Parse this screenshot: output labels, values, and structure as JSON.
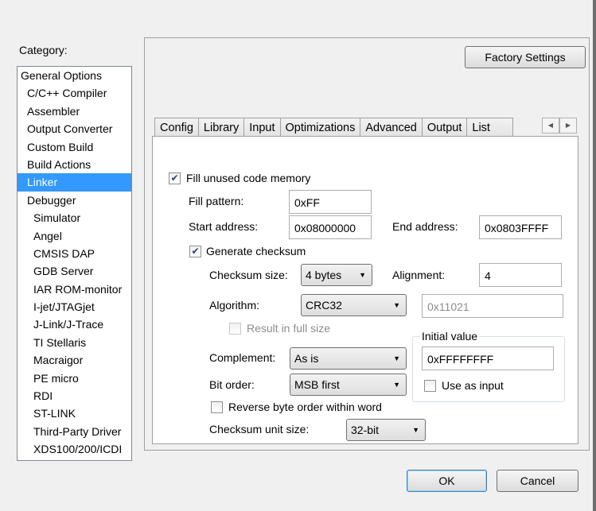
{
  "category_label": "Category:",
  "categories": [
    {
      "label": "General Options",
      "level": 0
    },
    {
      "label": "C/C++ Compiler",
      "level": 1
    },
    {
      "label": "Assembler",
      "level": 1
    },
    {
      "label": "Output Converter",
      "level": 1
    },
    {
      "label": "Custom Build",
      "level": 1
    },
    {
      "label": "Build Actions",
      "level": 1
    },
    {
      "label": "Linker",
      "level": 1,
      "selected": true
    },
    {
      "label": "Debugger",
      "level": 1
    },
    {
      "label": "Simulator",
      "level": 2
    },
    {
      "label": "Angel",
      "level": 2
    },
    {
      "label": "CMSIS DAP",
      "level": 2
    },
    {
      "label": "GDB Server",
      "level": 2
    },
    {
      "label": "IAR ROM-monitor",
      "level": 2
    },
    {
      "label": "I-jet/JTAGjet",
      "level": 2
    },
    {
      "label": "J-Link/J-Trace",
      "level": 2
    },
    {
      "label": "TI Stellaris",
      "level": 2
    },
    {
      "label": "Macraigor",
      "level": 2
    },
    {
      "label": "PE micro",
      "level": 2
    },
    {
      "label": "RDI",
      "level": 2
    },
    {
      "label": "ST-LINK",
      "level": 2
    },
    {
      "label": "Third-Party Driver",
      "level": 2
    },
    {
      "label": "XDS100/200/ICDI",
      "level": 2
    }
  ],
  "factory_settings": "Factory Settings",
  "tabs": [
    "Config",
    "Library",
    "Input",
    "Optimizations",
    "Advanced",
    "Output",
    "List"
  ],
  "form": {
    "fill_unused": "Fill unused code memory",
    "fill_pattern_label": "Fill pattern:",
    "fill_pattern": "0xFF",
    "start_label": "Start address:",
    "start": "0x08000000",
    "end_label": "End address:",
    "end": "0x0803FFFF",
    "gen_checksum": "Generate checksum",
    "cs_size_label": "Checksum size:",
    "cs_size": "4 bytes",
    "align_label": "Alignment:",
    "align": "4",
    "algo_label": "Algorithm:",
    "algo": "CRC32",
    "poly": "0x11021",
    "full_size": "Result in full size",
    "init_group": "Initial value",
    "init": "0xFFFFFFFF",
    "use_input": "Use as input",
    "compl_label": "Complement:",
    "compl": "As is",
    "bit_label": "Bit order:",
    "bit": "MSB first",
    "reverse": "Reverse byte order within word",
    "unit_label": "Checksum unit size:",
    "unit": "32-bit"
  },
  "ok": "OK",
  "cancel": "Cancel"
}
